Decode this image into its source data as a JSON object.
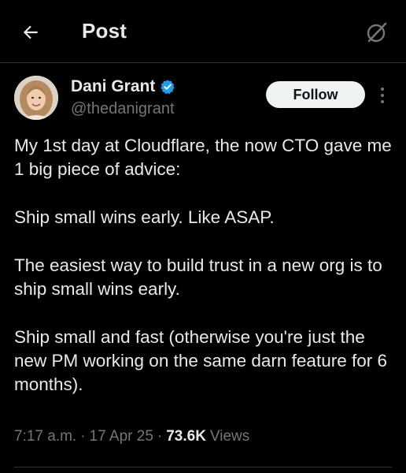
{
  "header": {
    "title": "Post",
    "back_icon": "arrow-left-icon",
    "grok_icon": "grok-slash-circle-icon"
  },
  "author": {
    "display_name": "Dani Grant",
    "handle": "@thedanigrant",
    "verified": true,
    "verified_color": "#1d9bf0",
    "avatar_icon": "profile-photo-avatar"
  },
  "actions": {
    "follow_label": "Follow",
    "more_icon": "more-vertical-icon"
  },
  "tweet": {
    "paragraphs": [
      "My 1st day at Cloudflare, the now CTO gave me 1 big piece of advice:",
      "Ship small wins early. Like ASAP.",
      "The easiest way to build trust in a new org is to ship small wins early.",
      "Ship small and fast (otherwise you're just the new PM working on the same darn feature for 6 months)."
    ]
  },
  "meta": {
    "time": "7:17 a.m.",
    "separator": "·",
    "date": "17 Apr 25",
    "views_count": "73.6K",
    "views_label": "Views"
  },
  "colors": {
    "background": "#000000",
    "text_primary": "#e7e9ea",
    "text_secondary": "#71767b",
    "divider": "#2f3336",
    "follow_bg": "#eff3f4"
  }
}
